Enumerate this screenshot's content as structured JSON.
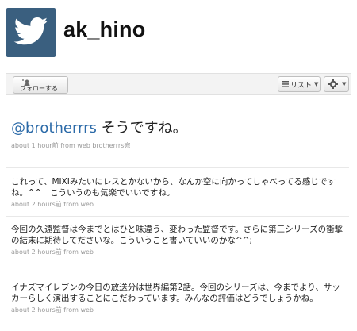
{
  "profile": {
    "username": "ak_hino"
  },
  "actions": {
    "follow_label": "フォローする",
    "list_label": "リスト",
    "brand_color": "#3a5f7f"
  },
  "main_tweet": {
    "mention": "@brotherrrs",
    "text": " そうですね。",
    "meta": "about 1 hour前 from web brotherrrs宛"
  },
  "tweets": [
    {
      "text": "これって、MIXIみたいにレスとかないから、なんか空に向かってしゃべってる感じですね。^^　こういうのも気楽でいいですね。",
      "meta": "about 2 hours前 from web"
    },
    {
      "text": "今回の久遠監督は今までとはひと味違う、変わった監督です。さらに第三シリーズの衝撃の結末に期待してださいな。こういうこと書いていいのかな^^;",
      "meta": "about 2 hours前 from web"
    },
    {
      "text": "イナズマイレブンの今日の放送分は世界編第2話。今回のシリーズは、今までより、サッカーらしく演出することにこだわっています。みんなの評価はどうでしょうかね。",
      "meta": "about 2 hours前 from web"
    }
  ]
}
